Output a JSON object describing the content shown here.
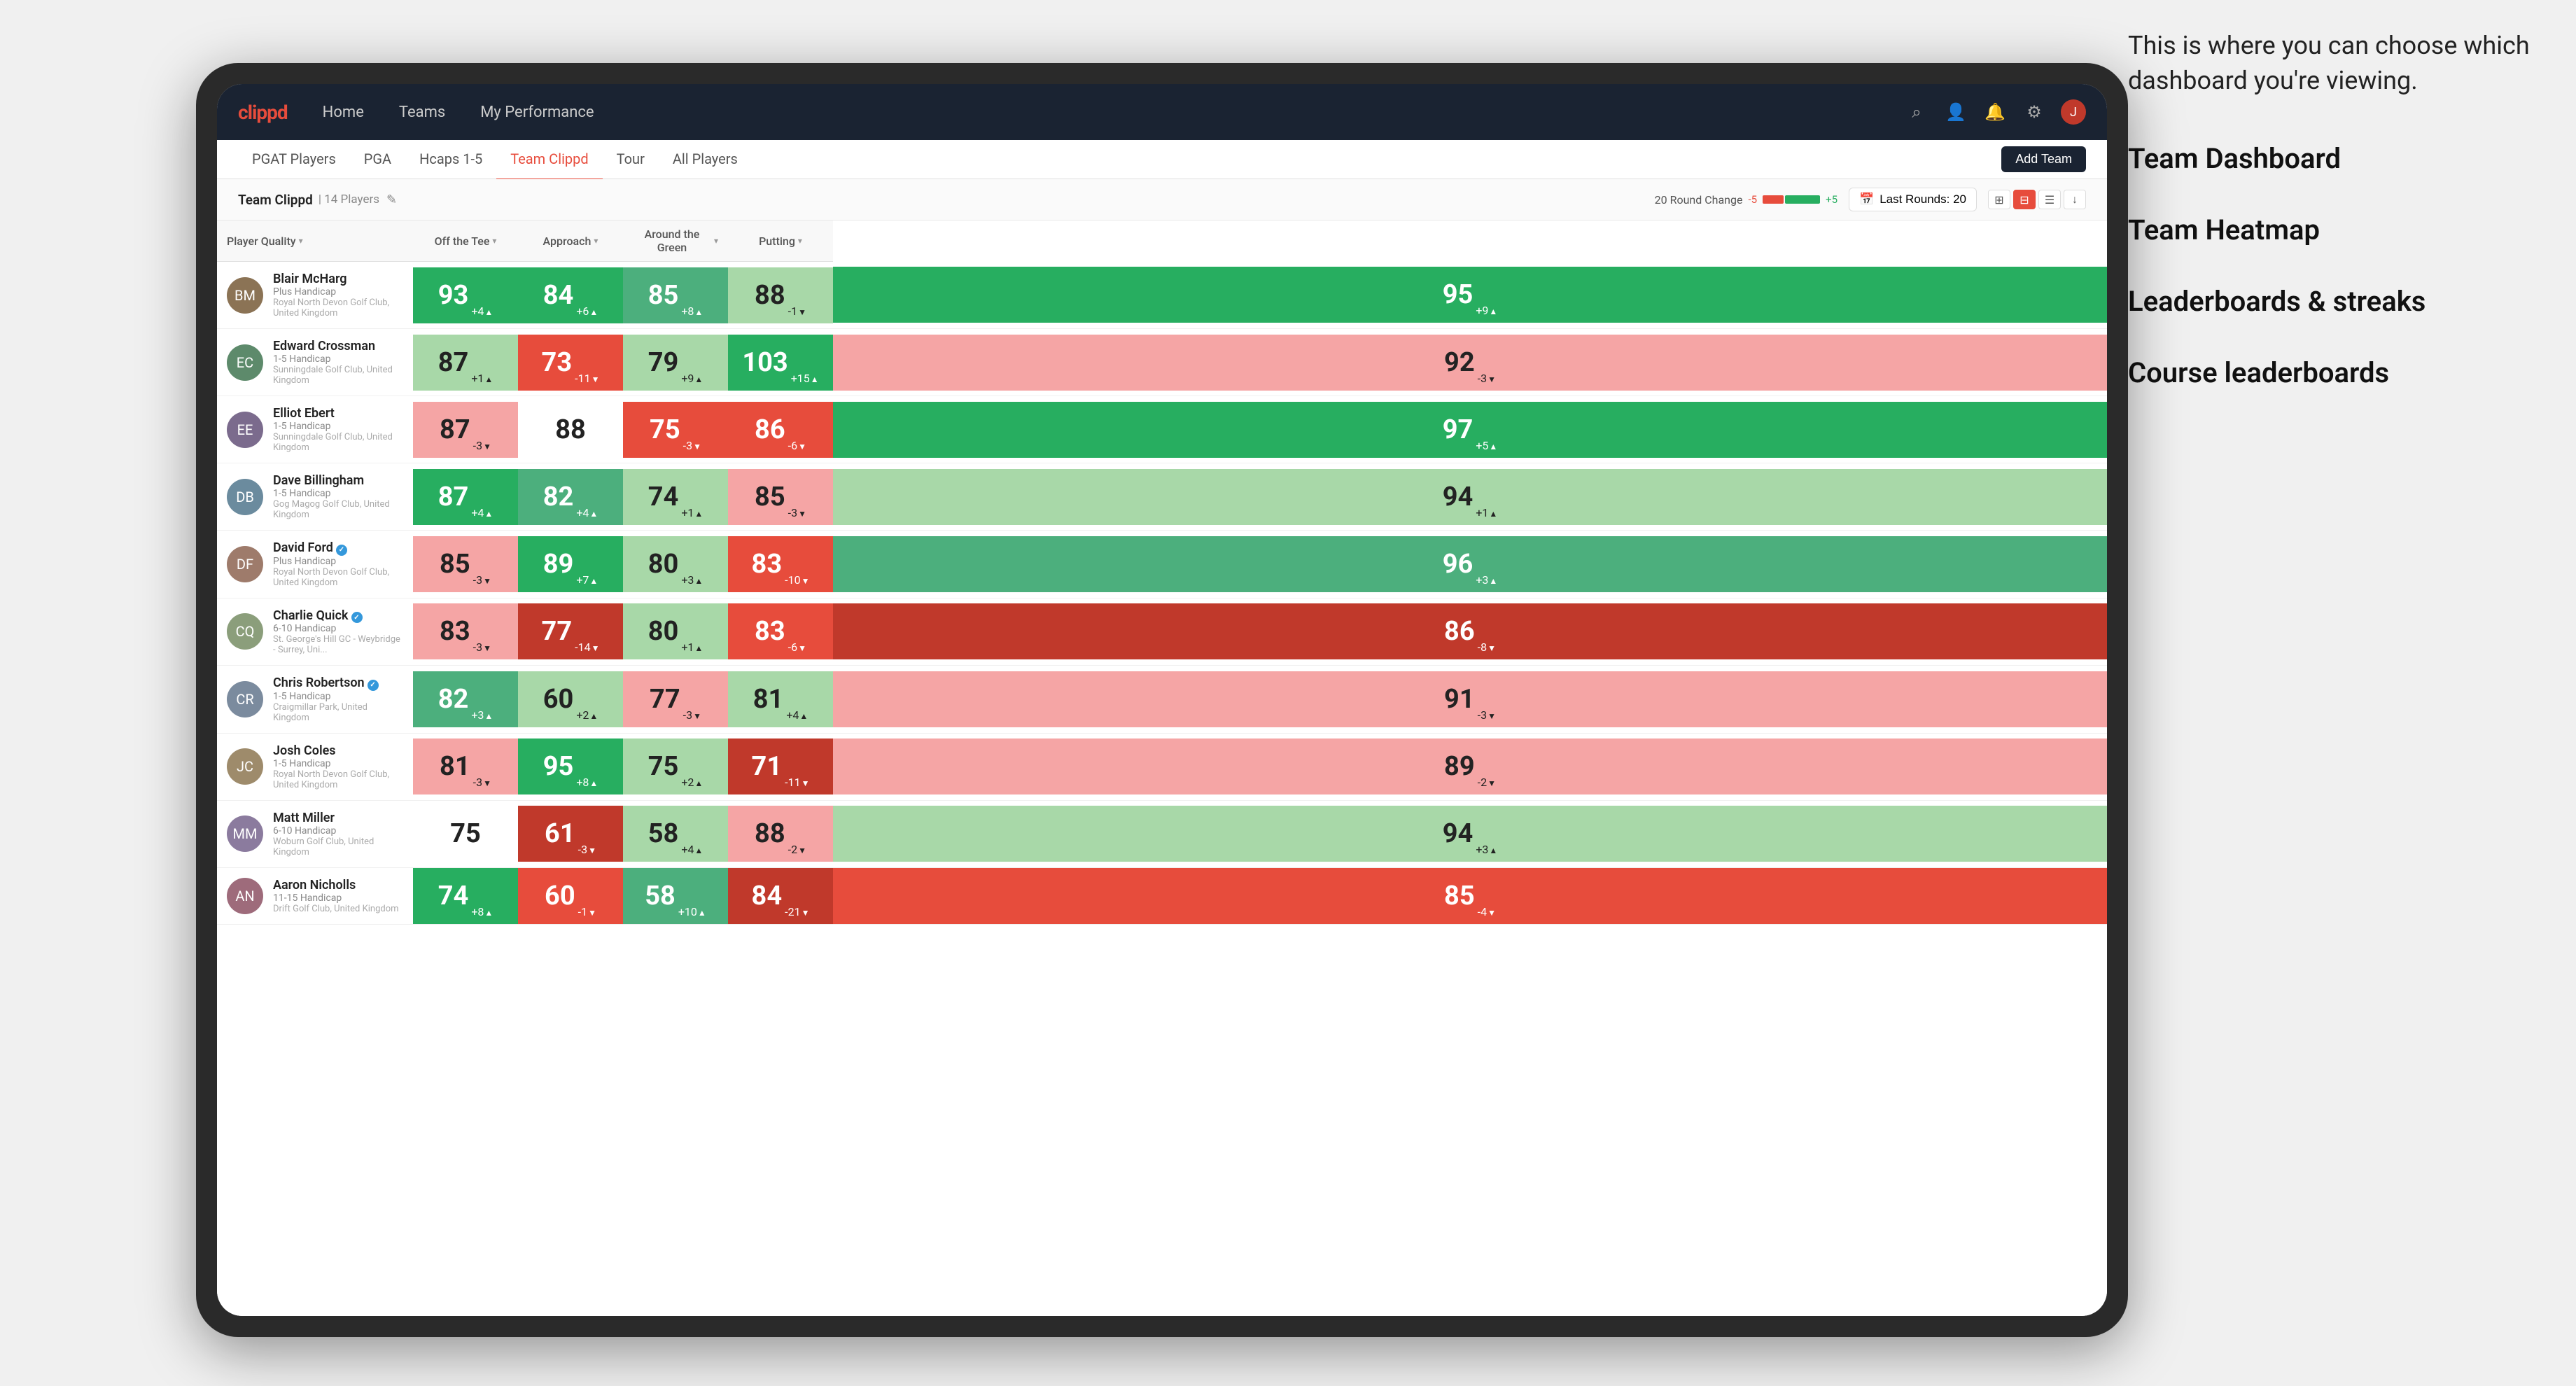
{
  "annotation": {
    "intro": "This is where you can choose which dashboard you're viewing.",
    "items": [
      "Team Dashboard",
      "Team Heatmap",
      "Leaderboards & streaks",
      "Course leaderboards"
    ]
  },
  "navbar": {
    "logo": "clippd",
    "nav_items": [
      "Home",
      "Teams",
      "My Performance"
    ],
    "icons": [
      "search",
      "person",
      "bell",
      "settings",
      "avatar"
    ]
  },
  "subnav": {
    "tabs": [
      {
        "label": "PGAT Players",
        "active": false
      },
      {
        "label": "PGA",
        "active": false
      },
      {
        "label": "Hcaps 1-5",
        "active": false
      },
      {
        "label": "Team Clippd",
        "active": true
      },
      {
        "label": "Tour",
        "active": false
      },
      {
        "label": "All Players",
        "active": false
      }
    ],
    "add_team_label": "Add Team"
  },
  "team_header": {
    "name": "Team Clippd",
    "separator": "|",
    "count": "14 Players",
    "round_change_label": "20 Round Change",
    "change_neg": "-5",
    "change_pos": "+5",
    "last_rounds_label": "Last Rounds:",
    "last_rounds_value": "20"
  },
  "table": {
    "columns": [
      {
        "key": "player",
        "label": "Player Quality",
        "sortable": true
      },
      {
        "key": "off_tee",
        "label": "Off the Tee",
        "sortable": true
      },
      {
        "key": "approach",
        "label": "Approach",
        "sortable": true
      },
      {
        "key": "around_green",
        "label": "Around the Green",
        "sortable": true
      },
      {
        "key": "putting",
        "label": "Putting",
        "sortable": true
      }
    ],
    "rows": [
      {
        "name": "Blair McHarg",
        "hcp": "Plus Handicap",
        "club": "Royal North Devon Golf Club, United Kingdom",
        "verified": false,
        "avatar_color": "#8B7355",
        "initials": "BM",
        "player_quality": {
          "value": 93,
          "change": "+4",
          "direction": "up",
          "color": "dark-green"
        },
        "off_tee": {
          "value": 84,
          "change": "+6",
          "direction": "up",
          "color": "dark-green"
        },
        "approach": {
          "value": 85,
          "change": "+8",
          "direction": "up",
          "color": "mid-green"
        },
        "around_green": {
          "value": 88,
          "change": "-1",
          "direction": "down",
          "color": "light-green"
        },
        "putting": {
          "value": 95,
          "change": "+9",
          "direction": "up",
          "color": "dark-green"
        }
      },
      {
        "name": "Edward Crossman",
        "hcp": "1-5 Handicap",
        "club": "Sunningdale Golf Club, United Kingdom",
        "verified": false,
        "avatar_color": "#5D8A6B",
        "initials": "EC",
        "player_quality": {
          "value": 87,
          "change": "+1",
          "direction": "up",
          "color": "light-green"
        },
        "off_tee": {
          "value": 73,
          "change": "-11",
          "direction": "down",
          "color": "mid-red"
        },
        "approach": {
          "value": 79,
          "change": "+9",
          "direction": "up",
          "color": "light-green"
        },
        "around_green": {
          "value": 103,
          "change": "+15",
          "direction": "up",
          "color": "dark-green"
        },
        "putting": {
          "value": 92,
          "change": "-3",
          "direction": "down",
          "color": "light-red"
        }
      },
      {
        "name": "Elliot Ebert",
        "hcp": "1-5 Handicap",
        "club": "Sunningdale Golf Club, United Kingdom",
        "verified": false,
        "avatar_color": "#7B6B8D",
        "initials": "EE",
        "player_quality": {
          "value": 87,
          "change": "-3",
          "direction": "down",
          "color": "light-red"
        },
        "off_tee": {
          "value": 88,
          "change": "",
          "direction": "",
          "color": "white"
        },
        "approach": {
          "value": 75,
          "change": "-3",
          "direction": "down",
          "color": "mid-red"
        },
        "around_green": {
          "value": 86,
          "change": "-6",
          "direction": "down",
          "color": "mid-red"
        },
        "putting": {
          "value": 97,
          "change": "+5",
          "direction": "up",
          "color": "dark-green"
        }
      },
      {
        "name": "Dave Billingham",
        "hcp": "1-5 Handicap",
        "club": "Gog Magog Golf Club, United Kingdom",
        "verified": false,
        "avatar_color": "#6B8B9E",
        "initials": "DB",
        "player_quality": {
          "value": 87,
          "change": "+4",
          "direction": "up",
          "color": "dark-green"
        },
        "off_tee": {
          "value": 82,
          "change": "+4",
          "direction": "up",
          "color": "mid-green"
        },
        "approach": {
          "value": 74,
          "change": "+1",
          "direction": "up",
          "color": "light-green"
        },
        "around_green": {
          "value": 85,
          "change": "-3",
          "direction": "down",
          "color": "light-red"
        },
        "putting": {
          "value": 94,
          "change": "+1",
          "direction": "up",
          "color": "light-green"
        }
      },
      {
        "name": "David Ford",
        "hcp": "Plus Handicap",
        "club": "Royal North Devon Golf Club, United Kingdom",
        "verified": true,
        "avatar_color": "#9E7B6B",
        "initials": "DF",
        "player_quality": {
          "value": 85,
          "change": "-3",
          "direction": "down",
          "color": "light-red"
        },
        "off_tee": {
          "value": 89,
          "change": "+7",
          "direction": "up",
          "color": "dark-green"
        },
        "approach": {
          "value": 80,
          "change": "+3",
          "direction": "up",
          "color": "light-green"
        },
        "around_green": {
          "value": 83,
          "change": "-10",
          "direction": "down",
          "color": "mid-red"
        },
        "putting": {
          "value": 96,
          "change": "+3",
          "direction": "up",
          "color": "mid-green"
        }
      },
      {
        "name": "Charlie Quick",
        "hcp": "6-10 Handicap",
        "club": "St. George's Hill GC - Weybridge - Surrey, Uni...",
        "verified": true,
        "avatar_color": "#8B9E7B",
        "initials": "CQ",
        "player_quality": {
          "value": 83,
          "change": "-3",
          "direction": "down",
          "color": "light-red"
        },
        "off_tee": {
          "value": 77,
          "change": "-14",
          "direction": "down",
          "color": "dark-red"
        },
        "approach": {
          "value": 80,
          "change": "+1",
          "direction": "up",
          "color": "light-green"
        },
        "around_green": {
          "value": 83,
          "change": "-6",
          "direction": "down",
          "color": "mid-red"
        },
        "putting": {
          "value": 86,
          "change": "-8",
          "direction": "down",
          "color": "dark-red"
        }
      },
      {
        "name": "Chris Robertson",
        "hcp": "1-5 Handicap",
        "club": "Craigmillar Park, United Kingdom",
        "verified": true,
        "avatar_color": "#7B8B9E",
        "initials": "CR",
        "player_quality": {
          "value": 82,
          "change": "+3",
          "direction": "up",
          "color": "mid-green"
        },
        "off_tee": {
          "value": 60,
          "change": "+2",
          "direction": "up",
          "color": "light-green"
        },
        "approach": {
          "value": 77,
          "change": "-3",
          "direction": "down",
          "color": "light-red"
        },
        "around_green": {
          "value": 81,
          "change": "+4",
          "direction": "up",
          "color": "light-green"
        },
        "putting": {
          "value": 91,
          "change": "-3",
          "direction": "down",
          "color": "light-red"
        }
      },
      {
        "name": "Josh Coles",
        "hcp": "1-5 Handicap",
        "club": "Royal North Devon Golf Club, United Kingdom",
        "verified": false,
        "avatar_color": "#9E8B6B",
        "initials": "JC",
        "player_quality": {
          "value": 81,
          "change": "-3",
          "direction": "down",
          "color": "light-red"
        },
        "off_tee": {
          "value": 95,
          "change": "+8",
          "direction": "up",
          "color": "dark-green"
        },
        "approach": {
          "value": 75,
          "change": "+2",
          "direction": "up",
          "color": "light-green"
        },
        "around_green": {
          "value": 71,
          "change": "-11",
          "direction": "down",
          "color": "dark-red"
        },
        "putting": {
          "value": 89,
          "change": "-2",
          "direction": "down",
          "color": "light-red"
        }
      },
      {
        "name": "Matt Miller",
        "hcp": "6-10 Handicap",
        "club": "Woburn Golf Club, United Kingdom",
        "verified": false,
        "avatar_color": "#8B7B9E",
        "initials": "MM",
        "player_quality": {
          "value": 75,
          "change": "",
          "direction": "",
          "color": "white"
        },
        "off_tee": {
          "value": 61,
          "change": "-3",
          "direction": "down",
          "color": "dark-red"
        },
        "approach": {
          "value": 58,
          "change": "+4",
          "direction": "up",
          "color": "light-green"
        },
        "around_green": {
          "value": 88,
          "change": "-2",
          "direction": "down",
          "color": "light-red"
        },
        "putting": {
          "value": 94,
          "change": "+3",
          "direction": "up",
          "color": "light-green"
        }
      },
      {
        "name": "Aaron Nicholls",
        "hcp": "11-15 Handicap",
        "club": "Drift Golf Club, United Kingdom",
        "verified": false,
        "avatar_color": "#9E6B7B",
        "initials": "AN",
        "player_quality": {
          "value": 74,
          "change": "+8",
          "direction": "up",
          "color": "dark-green"
        },
        "off_tee": {
          "value": 60,
          "change": "-1",
          "direction": "down",
          "color": "mid-red"
        },
        "approach": {
          "value": 58,
          "change": "+10",
          "direction": "up",
          "color": "mid-green"
        },
        "around_green": {
          "value": 84,
          "change": "-21",
          "direction": "down",
          "color": "dark-red"
        },
        "putting": {
          "value": 85,
          "change": "-4",
          "direction": "down",
          "color": "mid-red"
        }
      }
    ]
  }
}
